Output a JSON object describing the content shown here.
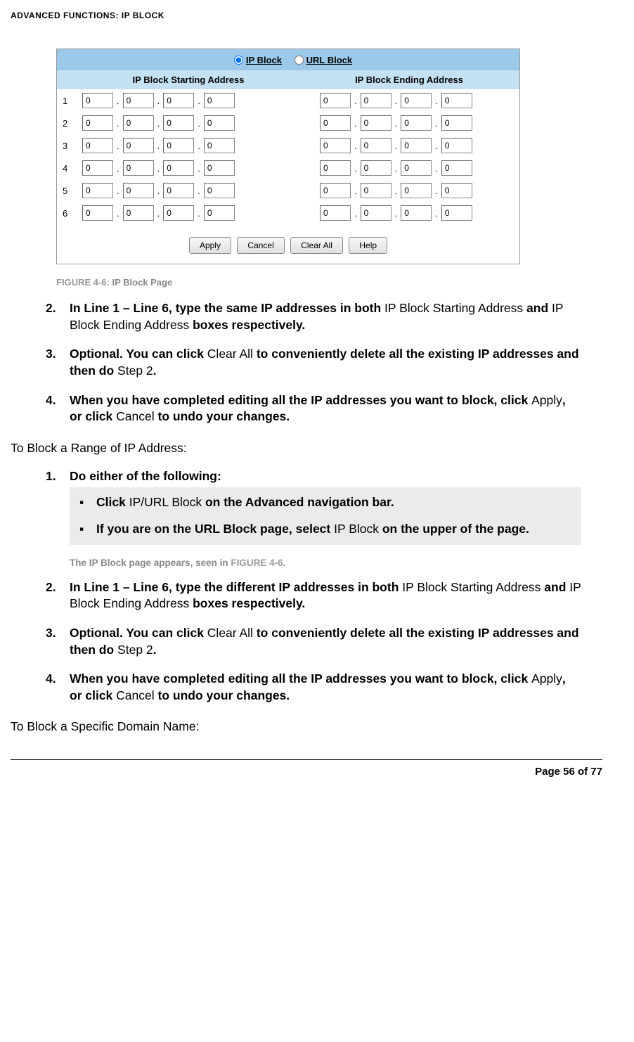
{
  "header": "ADVANCED FUNCTIONS: IP BLOCK",
  "figure": {
    "tabs": {
      "ip_block": "IP Block",
      "url_block": "URL Block"
    },
    "col_start": "IP Block Starting Address",
    "col_end": "IP Block Ending Address",
    "rows": [
      "1",
      "2",
      "3",
      "4",
      "5",
      "6"
    ],
    "octet_value": "0",
    "buttons": {
      "apply": "Apply",
      "cancel": "Cancel",
      "clear_all": "Clear All",
      "help": "Help"
    },
    "caption_prefix": "FIGURE 4-6: ",
    "caption_title": "IP Block Page"
  },
  "list_a": {
    "item2": {
      "num": "2.",
      "t1": "In Line 1 – Line 6, type the same IP addresses in both ",
      "t2": "IP Block Starting Address ",
      "t3": "and ",
      "t4": "IP Block Ending Address ",
      "t5": "boxes respectively."
    },
    "item3": {
      "num": "3.",
      "t1": "Optional. You can click ",
      "t2": "Clear All ",
      "t3": "to conveniently delete all the existing IP addresses and then do ",
      "t4": "Step 2",
      "t5": "."
    },
    "item4": {
      "num": "4.",
      "t1": "When you have completed editing all the IP addresses you want to block, click ",
      "t2": "Apply",
      "t3": ", or click ",
      "t4": "Cancel ",
      "t5": "to undo your changes."
    }
  },
  "section_b_title": "To Block a Range of IP Address:",
  "list_b": {
    "item1": {
      "num": "1.",
      "t1": "Do either of the following:",
      "sub1": {
        "b": "▪",
        "t1": "Click ",
        "t2": "IP/URL Block ",
        "t3": "on the Advanced navigation bar."
      },
      "sub2": {
        "b": "▪",
        "t1": "If you are on the URL Block page, select ",
        "t2": "IP Block ",
        "t3": "on the upper of the page."
      }
    },
    "result": {
      "t1": "The IP Block page appears, seen in ",
      "t2": "FIGURE 4-6",
      "t3": "."
    },
    "item2": {
      "num": "2.",
      "t1": "In Line 1 – Line 6, type the different IP addresses in both ",
      "t2": "IP Block Starting Address ",
      "t3": "and ",
      "t4": "IP Block Ending Address ",
      "t5": "boxes respectively."
    },
    "item3": {
      "num": "3.",
      "t1": "Optional. You can click ",
      "t2": "Clear All ",
      "t3": "to conveniently delete all the existing IP addresses and then do ",
      "t4": "Step 2",
      "t5": "."
    },
    "item4": {
      "num": "4.",
      "t1": "When you have completed editing all the IP addresses you want to block, click ",
      "t2": "Apply",
      "t3": ", or click ",
      "t4": "Cancel ",
      "t5": "to undo your changes."
    }
  },
  "section_c_title": "To Block a Specific Domain Name:",
  "footer": "Page 56 of 77"
}
